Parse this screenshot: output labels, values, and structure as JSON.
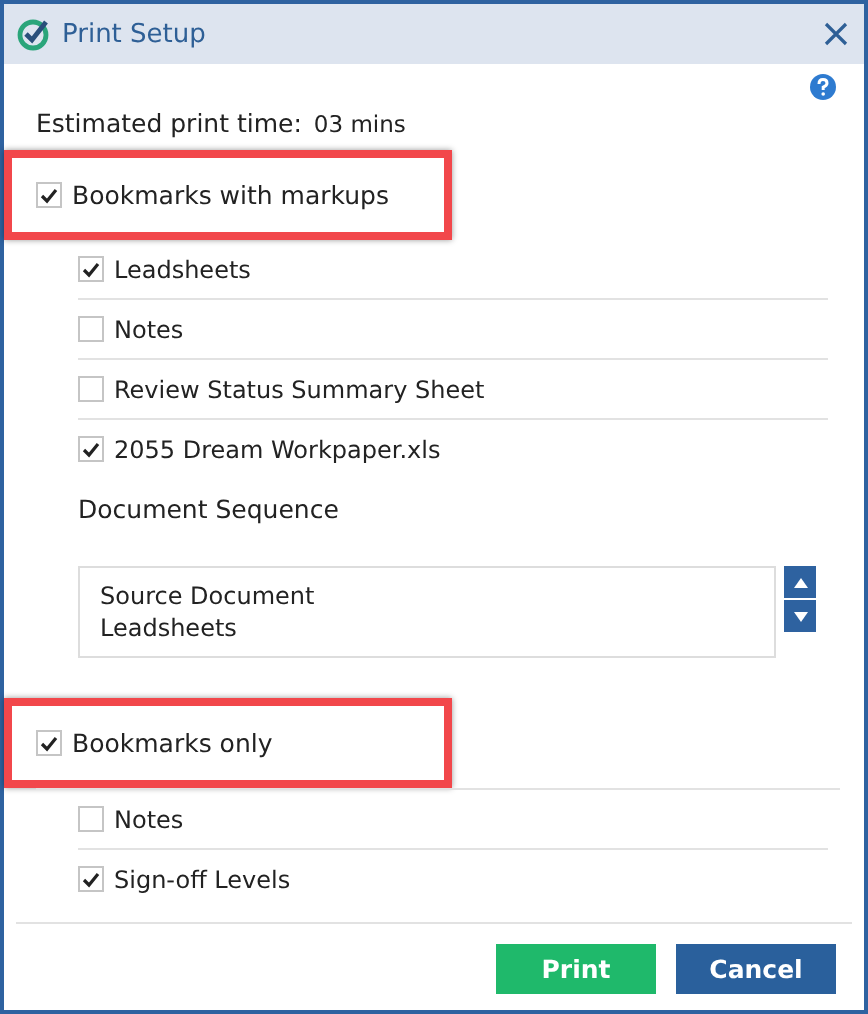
{
  "window": {
    "title": "Print Setup"
  },
  "estimate": {
    "label": "Estimated print time:",
    "value": "03 mins"
  },
  "sections": [
    {
      "label": "Bookmarks with markups",
      "checked": true,
      "highlighted": true,
      "items": [
        {
          "label": "Leadsheets",
          "checked": true
        },
        {
          "label": "Notes",
          "checked": false
        },
        {
          "label": "Review Status Summary Sheet",
          "checked": false
        },
        {
          "label": "2055 Dream Workpaper.xls",
          "checked": true
        }
      ],
      "sequence": {
        "title": "Document Sequence",
        "entries": [
          "Source Document",
          "Leadsheets"
        ]
      }
    },
    {
      "label": "Bookmarks only",
      "checked": true,
      "highlighted": true,
      "items": [
        {
          "label": "Notes",
          "checked": false
        },
        {
          "label": "Sign-off Levels",
          "checked": true
        }
      ]
    }
  ],
  "buttons": [
    {
      "label": "Print",
      "kind": "primary"
    },
    {
      "label": "Cancel",
      "kind": "secondary"
    }
  ]
}
